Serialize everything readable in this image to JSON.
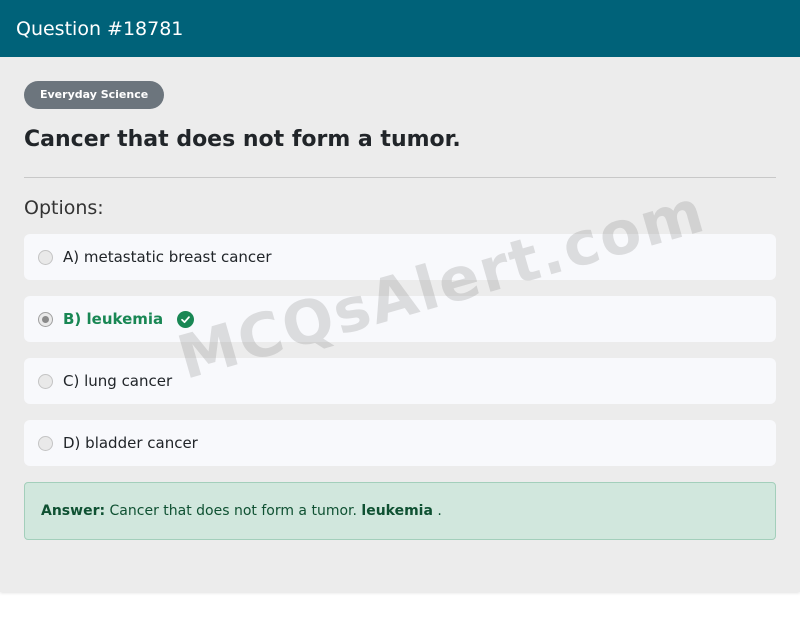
{
  "header": {
    "title": "Question #18781"
  },
  "category": {
    "label": "Everyday Science"
  },
  "question": {
    "text": "Cancer that does not form a tumor."
  },
  "options_heading": "Options:",
  "options": [
    {
      "label": "A) metastatic breast cancer",
      "selected": false,
      "correct": false
    },
    {
      "label": "B) leukemia",
      "selected": true,
      "correct": true
    },
    {
      "label": "C) lung cancer",
      "selected": false,
      "correct": false
    },
    {
      "label": "D) bladder cancer",
      "selected": false,
      "correct": false
    }
  ],
  "answer": {
    "prefix": "Answer:",
    "text": "Cancer that does not form a tumor.",
    "value": "leukemia",
    "suffix": "."
  },
  "watermark": "MCQsAlert.com",
  "colors": {
    "header_bg": "#006279",
    "correct": "#198754",
    "answer_bg": "#d1e7dd",
    "badge_bg": "#6c757d"
  }
}
